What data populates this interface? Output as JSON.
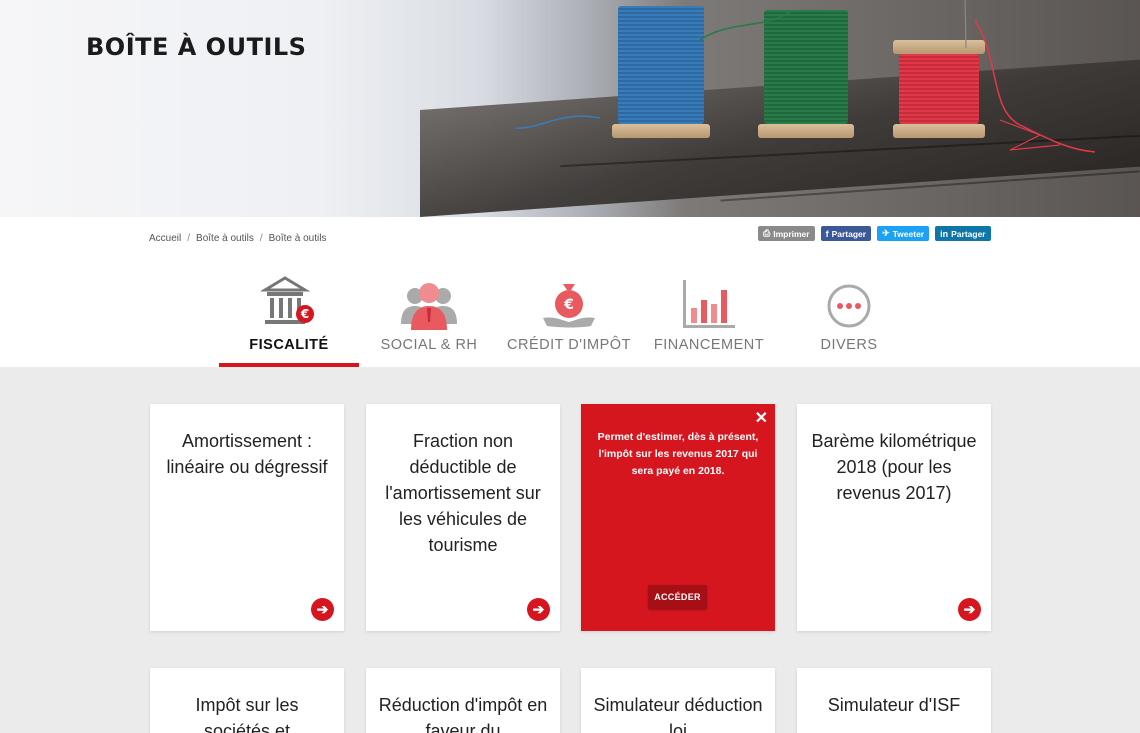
{
  "hero": {
    "title": "BOÎTE À OUTILS"
  },
  "breadcrumb": [
    "Accueil",
    "Boîte à outils",
    "Boîte à outils"
  ],
  "breadcrumb_separator": "/",
  "share": {
    "print_label": "Imprimer",
    "facebook_label": "Partager",
    "twitter_label": "Tweeter",
    "linkedin_label": "Partager"
  },
  "tabs": [
    {
      "label": "FISCALITÉ",
      "icon": "bank-euro-icon",
      "active": true
    },
    {
      "label": "SOCIAL & RH",
      "icon": "people-icon",
      "active": false
    },
    {
      "label": "CRÉDIT D'IMPÔT",
      "icon": "money-bag-hand-icon",
      "active": false
    },
    {
      "label": "FINANCEMENT",
      "icon": "bar-chart-icon",
      "active": false
    },
    {
      "label": "DIVERS",
      "icon": "more-dots-icon",
      "active": false
    }
  ],
  "cards_row1": [
    {
      "title": "Amortissement : linéaire ou dégressif"
    },
    {
      "title": "Fraction non déductible de l'amortissement sur les véhicules de tourisme"
    },
    {
      "description": "Permet d'estimer, dès à présent, l'impôt sur les revenus 2017 qui sera payé en 2018.",
      "button": "ACCÉDER",
      "close": "✕"
    },
    {
      "title": "Barème kilométrique 2018 (pour les revenus 2017)"
    }
  ],
  "cards_row2": [
    {
      "title": "Impôt sur les sociétés et"
    },
    {
      "title": "Réduction d'impôt en faveur du"
    },
    {
      "title": "Simulateur déduction loi"
    },
    {
      "title": "Simulateur d'ISF"
    }
  ],
  "colors": {
    "accent": "#d6161f",
    "accent_dark": "#a70f16",
    "page_bg": "#ebebeb"
  },
  "arrow_icon": "arrow-right-icon"
}
